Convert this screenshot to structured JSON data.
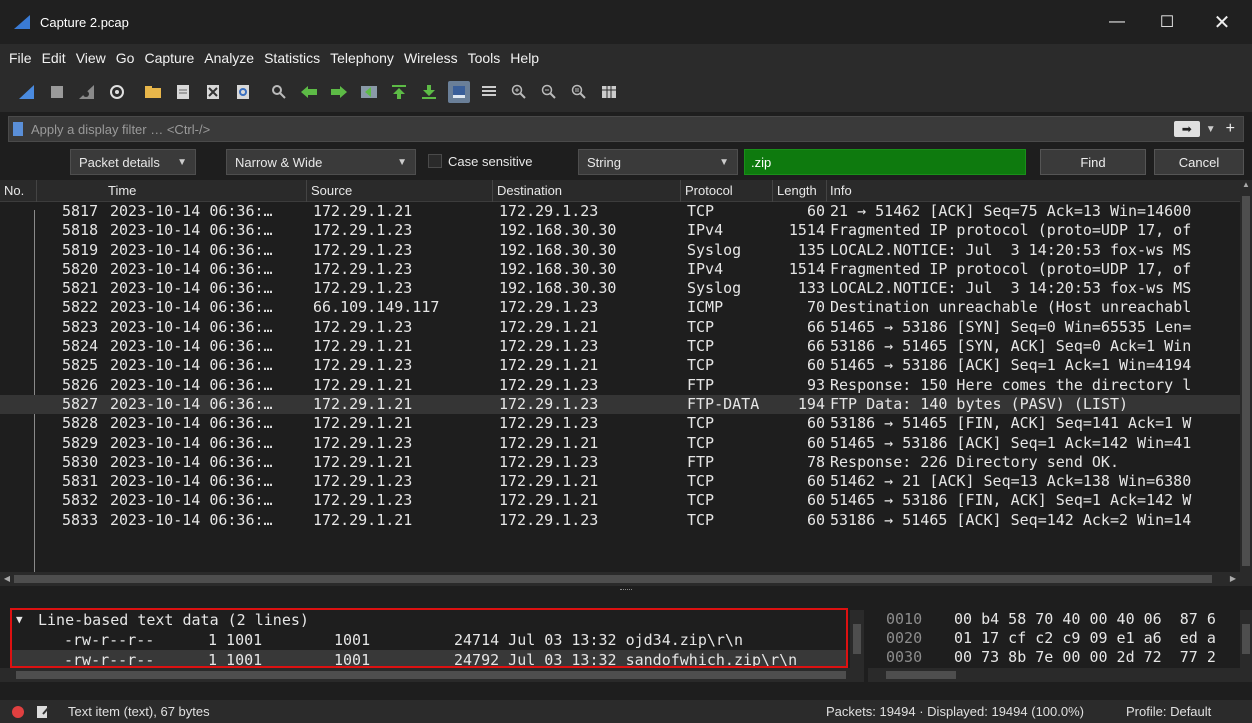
{
  "window": {
    "title": "Capture 2.pcap",
    "minimize": "—",
    "maximize": "☐",
    "close": "✕"
  },
  "menu": [
    "File",
    "Edit",
    "View",
    "Go",
    "Capture",
    "Analyze",
    "Statistics",
    "Telephony",
    "Wireless",
    "Tools",
    "Help"
  ],
  "toolbar": {
    "icons": [
      "shark-fin-icon",
      "stop-icon",
      "restart-icon",
      "options-gear-icon",
      "open-folder-icon",
      "file-icon",
      "close-file-icon",
      "reload-icon",
      "find-icon",
      "back-arrow-icon",
      "forward-arrow-icon",
      "go-to-packet-icon",
      "first-packet-icon",
      "last-packet-icon",
      "autoscroll-icon",
      "colorize-icon",
      "zoom-in-icon",
      "zoom-out-icon",
      "normal-size-icon",
      "resize-columns-icon"
    ],
    "selected": "autoscroll-icon"
  },
  "filter": {
    "placeholder": "Apply a display filter … <Ctrl-/>"
  },
  "find": {
    "search_in": "Packet details",
    "char_width": "Narrow & Wide",
    "case_sensitive_label": "Case sensitive",
    "search_type": "String",
    "query": ".zip",
    "find_label": "Find",
    "cancel_label": "Cancel"
  },
  "columns": {
    "no": "No.",
    "time": "Time",
    "source": "Source",
    "destination": "Destination",
    "protocol": "Protocol",
    "length": "Length",
    "info": "Info"
  },
  "packets": [
    {
      "no": "5817",
      "time": "2023-10-14 06:36:…",
      "src": "172.29.1.21",
      "dst": "172.29.1.23",
      "proto": "TCP",
      "len": "60",
      "info": "21 → 51462 [ACK] Seq=75 Ack=13 Win=14600"
    },
    {
      "no": "5818",
      "time": "2023-10-14 06:36:…",
      "src": "172.29.1.23",
      "dst": "192.168.30.30",
      "proto": "IPv4",
      "len": "1514",
      "info": "Fragmented IP protocol (proto=UDP 17, of"
    },
    {
      "no": "5819",
      "time": "2023-10-14 06:36:…",
      "src": "172.29.1.23",
      "dst": "192.168.30.30",
      "proto": "Syslog",
      "len": "135",
      "info": "LOCAL2.NOTICE: Jul  3 14:20:53 fox-ws MS"
    },
    {
      "no": "5820",
      "time": "2023-10-14 06:36:…",
      "src": "172.29.1.23",
      "dst": "192.168.30.30",
      "proto": "IPv4",
      "len": "1514",
      "info": "Fragmented IP protocol (proto=UDP 17, of"
    },
    {
      "no": "5821",
      "time": "2023-10-14 06:36:…",
      "src": "172.29.1.23",
      "dst": "192.168.30.30",
      "proto": "Syslog",
      "len": "133",
      "info": "LOCAL2.NOTICE: Jul  3 14:20:53 fox-ws MS"
    },
    {
      "no": "5822",
      "time": "2023-10-14 06:36:…",
      "src": "66.109.149.117",
      "dst": "172.29.1.23",
      "proto": "ICMP",
      "len": "70",
      "info": "Destination unreachable (Host unreachabl"
    },
    {
      "no": "5823",
      "time": "2023-10-14 06:36:…",
      "src": "172.29.1.23",
      "dst": "172.29.1.21",
      "proto": "TCP",
      "len": "66",
      "info": "51465 → 53186 [SYN] Seq=0 Win=65535 Len="
    },
    {
      "no": "5824",
      "time": "2023-10-14 06:36:…",
      "src": "172.29.1.21",
      "dst": "172.29.1.23",
      "proto": "TCP",
      "len": "66",
      "info": "53186 → 51465 [SYN, ACK] Seq=0 Ack=1 Win"
    },
    {
      "no": "5825",
      "time": "2023-10-14 06:36:…",
      "src": "172.29.1.23",
      "dst": "172.29.1.21",
      "proto": "TCP",
      "len": "60",
      "info": "51465 → 53186 [ACK] Seq=1 Ack=1 Win=4194"
    },
    {
      "no": "5826",
      "time": "2023-10-14 06:36:…",
      "src": "172.29.1.21",
      "dst": "172.29.1.23",
      "proto": "FTP",
      "len": "93",
      "info": "Response: 150 Here comes the directory l"
    },
    {
      "no": "5827",
      "time": "2023-10-14 06:36:…",
      "src": "172.29.1.21",
      "dst": "172.29.1.23",
      "proto": "FTP-DATA",
      "len": "194",
      "info": "FTP Data: 140 bytes (PASV) (LIST)",
      "selected": true
    },
    {
      "no": "5828",
      "time": "2023-10-14 06:36:…",
      "src": "172.29.1.21",
      "dst": "172.29.1.23",
      "proto": "TCP",
      "len": "60",
      "info": "53186 → 51465 [FIN, ACK] Seq=141 Ack=1 W"
    },
    {
      "no": "5829",
      "time": "2023-10-14 06:36:…",
      "src": "172.29.1.23",
      "dst": "172.29.1.21",
      "proto": "TCP",
      "len": "60",
      "info": "51465 → 53186 [ACK] Seq=1 Ack=142 Win=41"
    },
    {
      "no": "5830",
      "time": "2023-10-14 06:36:…",
      "src": "172.29.1.21",
      "dst": "172.29.1.23",
      "proto": "FTP",
      "len": "78",
      "info": "Response: 226 Directory send OK."
    },
    {
      "no": "5831",
      "time": "2023-10-14 06:36:…",
      "src": "172.29.1.23",
      "dst": "172.29.1.21",
      "proto": "TCP",
      "len": "60",
      "info": "51462 → 21 [ACK] Seq=13 Ack=138 Win=6380"
    },
    {
      "no": "5832",
      "time": "2023-10-14 06:36:…",
      "src": "172.29.1.23",
      "dst": "172.29.1.21",
      "proto": "TCP",
      "len": "60",
      "info": "51465 → 53186 [FIN, ACK] Seq=1 Ack=142 W"
    },
    {
      "no": "5833",
      "time": "2023-10-14 06:36:…",
      "src": "172.29.1.21",
      "dst": "172.29.1.23",
      "proto": "TCP",
      "len": "60",
      "info": "53186 → 51465 [ACK] Seq=142 Ack=2 Win=14"
    }
  ],
  "details": {
    "header": "Line-based text data (2 lines)",
    "lines": [
      {
        "perm": "-rw-r--r--",
        "links": "1 1001",
        "group": "1001",
        "rest": "24714 Jul 03 13:32 ojd34.zip\\r\\n"
      },
      {
        "perm": "-rw-r--r--",
        "links": "1 1001",
        "group": "1001",
        "rest": "24792 Jul 03 13:32 sandofwhich.zip\\r\\n"
      }
    ]
  },
  "bytes": [
    {
      "offset": "0010",
      "hex": "00 b4 58 70 40 00 40 06  87 6"
    },
    {
      "offset": "0020",
      "hex": "01 17 cf c2 c9 09 e1 a6  ed a"
    },
    {
      "offset": "0030",
      "hex": "00 73 8b 7e 00 00 2d 72  77 2"
    }
  ],
  "status": {
    "item_text": "Text item (text), 67 bytes",
    "packets": "Packets: 19494 · Displayed: 19494 (100.0%)",
    "profile": "Profile: Default"
  },
  "colors": {
    "find_input_bg": "#0e7a0e",
    "highlight_border": "#dd1111",
    "selected_row_bg": "#353535"
  }
}
